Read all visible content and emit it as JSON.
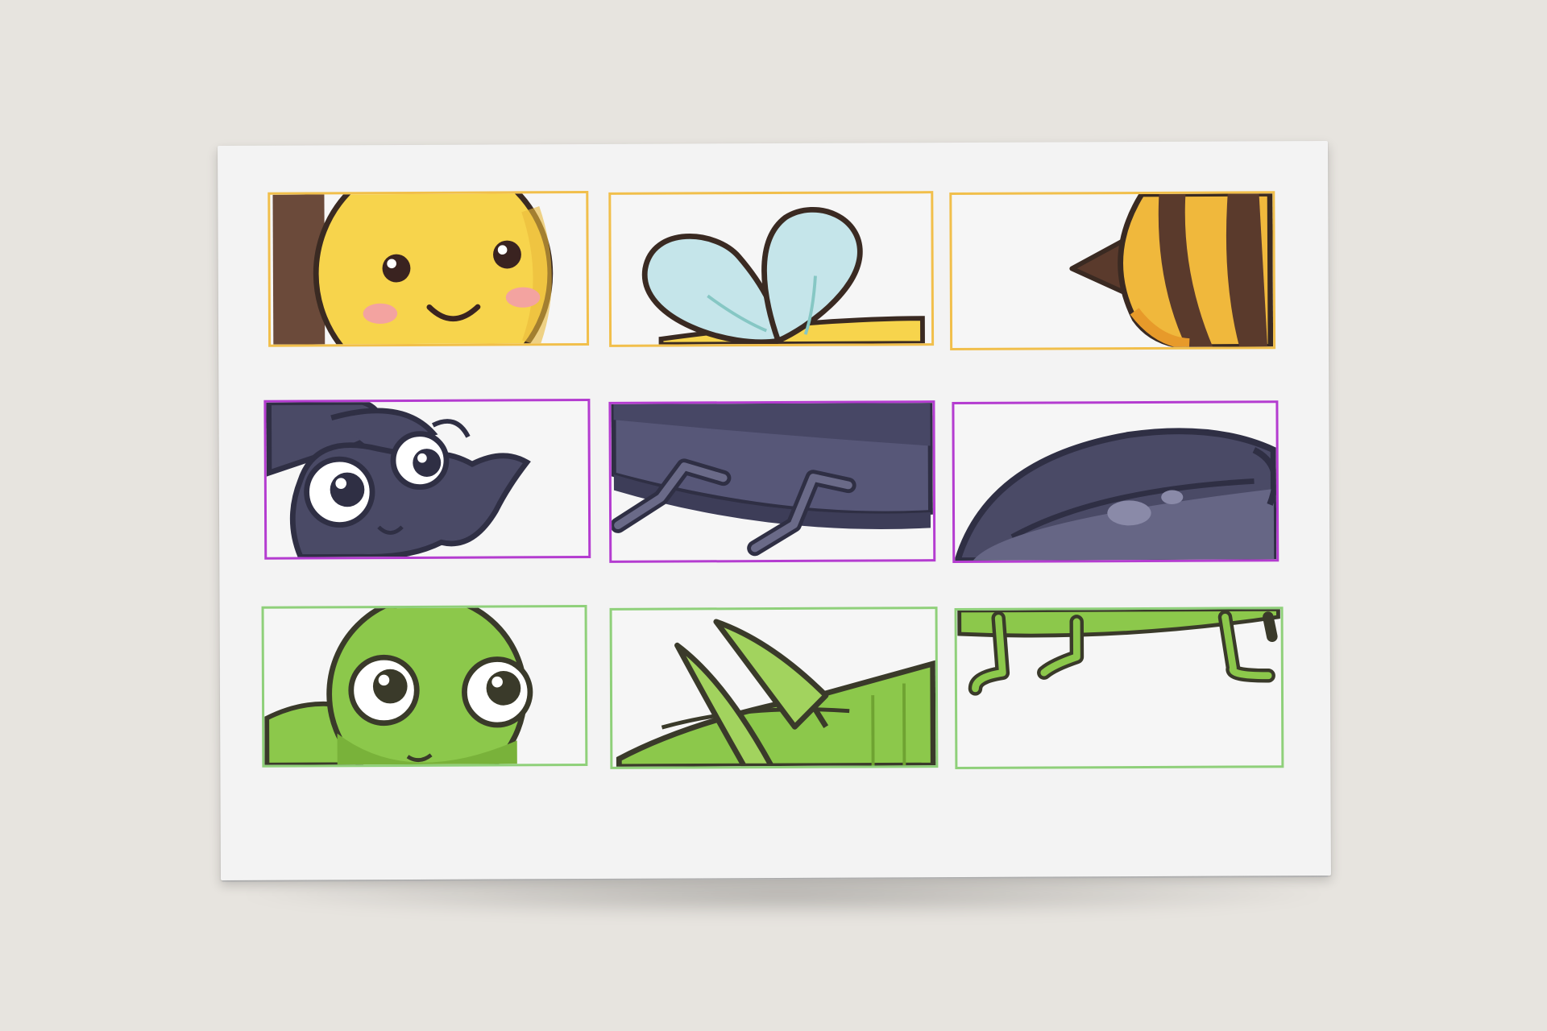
{
  "puzzle": {
    "rows": [
      {
        "animal": "bee",
        "frame_color": "#f1bf4b",
        "pieces": [
          "bee-head",
          "bee-wings",
          "bee-stinger"
        ]
      },
      {
        "animal": "beetle",
        "frame_color": "#b43cd0",
        "pieces": [
          "beetle-head",
          "beetle-legs",
          "beetle-shell"
        ]
      },
      {
        "animal": "grasshopper",
        "frame_color": "#8fd07a",
        "pieces": [
          "grasshopper-head",
          "grasshopper-wings",
          "grasshopper-legs"
        ]
      }
    ]
  },
  "colors": {
    "background": "#e7e4df",
    "paper": "#f3f3f3",
    "outline": "#3a2a22",
    "bee_yellow": "#f7d44c",
    "bee_brown": "#5a3a2c",
    "wing_blue": "#c5e5ea",
    "beetle_purple": "#4a4a66",
    "grasshopper_green": "#8cc84b"
  }
}
